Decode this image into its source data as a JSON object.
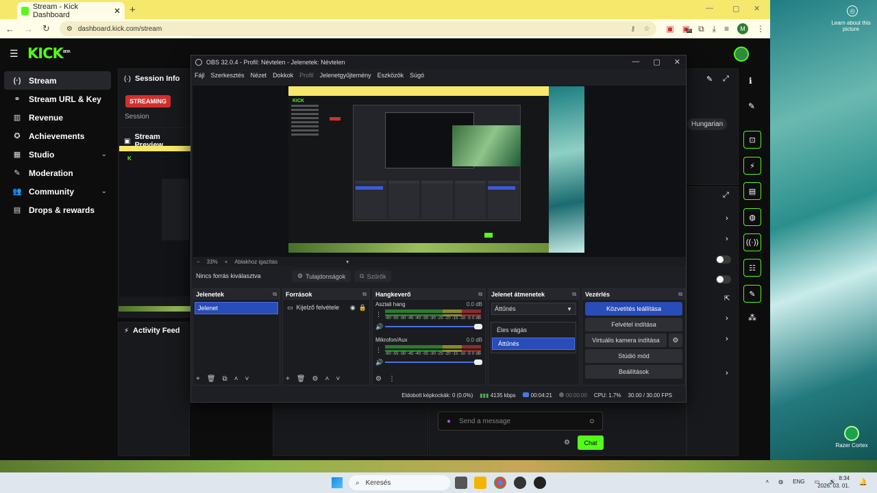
{
  "browser": {
    "tab_title": "Stream - Kick Dashboard",
    "url": "dashboard.kick.com/stream",
    "profile_initial": "M",
    "ext_badge": "20"
  },
  "kick": {
    "logo": "KICK",
    "logo_sup": "BETA",
    "sidebar": [
      {
        "label": "Stream",
        "icon": "broadcast-icon",
        "glyph": "(·)",
        "active": true
      },
      {
        "label": "Stream URL & Key",
        "icon": "link-icon",
        "glyph": "⚭"
      },
      {
        "label": "Revenue",
        "icon": "bar-chart-icon",
        "glyph": "▥"
      },
      {
        "label": "Achievements",
        "icon": "trophy-icon",
        "glyph": "✪"
      },
      {
        "label": "Studio",
        "icon": "grid-icon",
        "glyph": "▦",
        "chevron": true
      },
      {
        "label": "Moderation",
        "icon": "wrench-icon",
        "glyph": "✎"
      },
      {
        "label": "Community",
        "icon": "people-icon",
        "glyph": "👥",
        "chevron": true
      },
      {
        "label": "Drops & rewards",
        "icon": "gift-icon",
        "glyph": "▤"
      }
    ],
    "session_info_title": "Session Info",
    "streaming_badge": "STREAMING",
    "session_label": "Session",
    "stream_preview_title": "Stream Preview",
    "activity_feed_title": "Activity Feed",
    "language_chip": "Hungarian",
    "chat_placeholder": "Send a message",
    "chat_button": "Chat"
  },
  "obs": {
    "title": "OBS 32.0.4 - Profil: Névtelen - Jelenetek: Névtelen",
    "menu": [
      "Fájl",
      "Szerkesztés",
      "Nézet",
      "Dokkok",
      "Profil",
      "Jelenetgyűjtemény",
      "Eszközök",
      "Súgó"
    ],
    "zoom": "33%",
    "fit_label": "Ablakhoz igazítás",
    "no_source": "Nincs forrás kiválasztva",
    "properties_btn": "Tulajdonságok",
    "filters_btn": "Szűrők",
    "docks": {
      "scenes_title": "Jelenetek",
      "sources_title": "Források",
      "mixer_title": "Hangkeverő",
      "transitions_title": "Jelenet átmenetek",
      "controls_title": "Vezérlés"
    },
    "scene": "Jelenet",
    "source": "Kijelző felvétele",
    "mixer": [
      {
        "name": "Asztali hang",
        "db": "0.0 dB"
      },
      {
        "name": "Mikrofon/Aux",
        "db": "0.0 dB"
      }
    ],
    "meter_ticks": [
      "-60",
      "-55",
      "-50",
      "-45",
      "-40",
      "-35",
      "-30",
      "-25",
      "-20",
      "-15",
      "-10",
      "-5",
      "0"
    ],
    "meter_unit": "dB",
    "transition_selected": "Áttűnés",
    "transition_options": [
      "Éles vágás",
      "Áttűnés"
    ],
    "controls": {
      "stop_stream": "Közvetítés leállítása",
      "start_recording": "Felvétel indítása",
      "virtual_cam": "Virtuális kamera indítása",
      "studio_mode": "Stúdió mód",
      "settings": "Beállítások"
    },
    "status": {
      "dropped": "Eldobott képkockák: 0 (0.0%)",
      "bitrate": "4135 kbps",
      "live_time": "00:04:21",
      "rec_time": "00:00:00",
      "cpu": "CPU: 1.7%",
      "fps": "30.00 / 30.00 FPS"
    }
  },
  "desktop": {
    "learn_about": "Learn about this picture",
    "razer": "Razer Cortex"
  },
  "taskbar": {
    "search": "Keresés",
    "lang": "ENG",
    "time": "8:34",
    "date": "2026. 03. 01."
  },
  "colors": {
    "kick_green": "#53fc18",
    "obs_blue": "#284cb8",
    "tab_yellow": "#f5e86b"
  }
}
